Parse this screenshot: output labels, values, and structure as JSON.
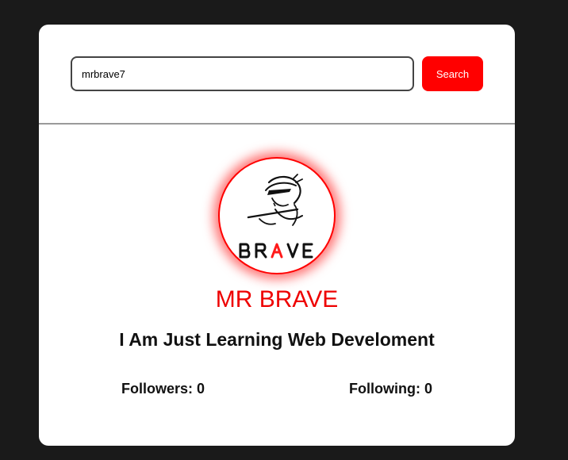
{
  "search": {
    "value": "mrbrave7",
    "button_label": "Search"
  },
  "profile": {
    "avatar_text_letters": [
      "B",
      "R",
      "A",
      "V",
      "E"
    ],
    "name": "MR BRAVE",
    "bio": "I Am Just Learning Web Develoment",
    "followers_label": "Followers: 0",
    "following_label": "Following: 0"
  },
  "colors": {
    "accent": "#ff0000",
    "background": "#1a1a1a",
    "card": "#ffffff"
  }
}
